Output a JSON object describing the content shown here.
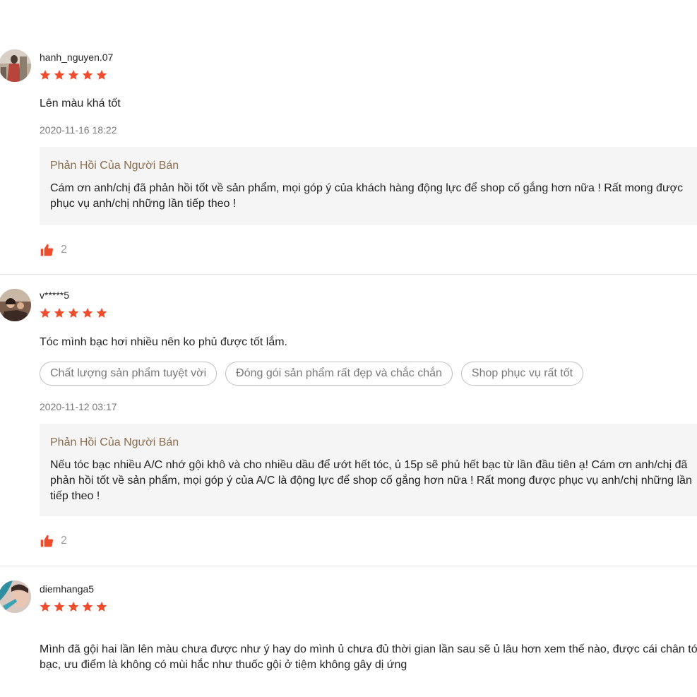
{
  "accent_color": "#ee4d2d",
  "reviews": [
    {
      "username": "hanh_nguyen.07",
      "rating": 5,
      "comment": "Lên màu khá tốt",
      "date": "2020-11-16 18:22",
      "reply_title": "Phản Hồi Của Người Bán",
      "reply_text": "Cám ơn anh/chị đã phản hồi tốt về sản phẩm, mọi góp ý của khách hàng động lực để shop cố gắng hơn nữa ! Rất mong được phục vụ anh/chị những lần tiếp theo !",
      "likes": "2"
    },
    {
      "username": "v*****5",
      "rating": 5,
      "comment": "Tóc mình bạc hơi nhiều nên ko phủ được tốt lắm.",
      "tags": [
        "Chất lượng sản phẩm tuyệt vời",
        "Đóng gói sản phẩm rất đẹp và chắc chắn",
        "Shop phục vụ rất tốt"
      ],
      "date": "2020-11-12 03:17",
      "reply_title": "Phản Hồi Của Người Bán",
      "reply_text": "Nếu tóc bạc nhiều A/C nhớ gội khô và cho nhiều dầu để ướt hết tóc, ủ 15p sẽ phủ hết bạc từ lần đầu tiên ạ! Cám ơn anh/chị đã phản hồi tốt về sản phẩm, mọi góp ý của A/C là động lực để shop cố gắng hơn nữa ! Rất mong được phục vụ anh/chị những lần tiếp theo !",
      "likes": "2"
    },
    {
      "username": "diemhanga5",
      "rating": 5,
      "comment": "Mình đã gội hai lần lên màu chưa được như ý hay do mình ủ chưa đủ thời gian lần sau sẽ ủ lâu hơn xem thế nào, được cái chân tóc bạc, ưu điểm là không có mùi hắc như thuốc gội ở tiệm không gây dị ứng"
    }
  ]
}
